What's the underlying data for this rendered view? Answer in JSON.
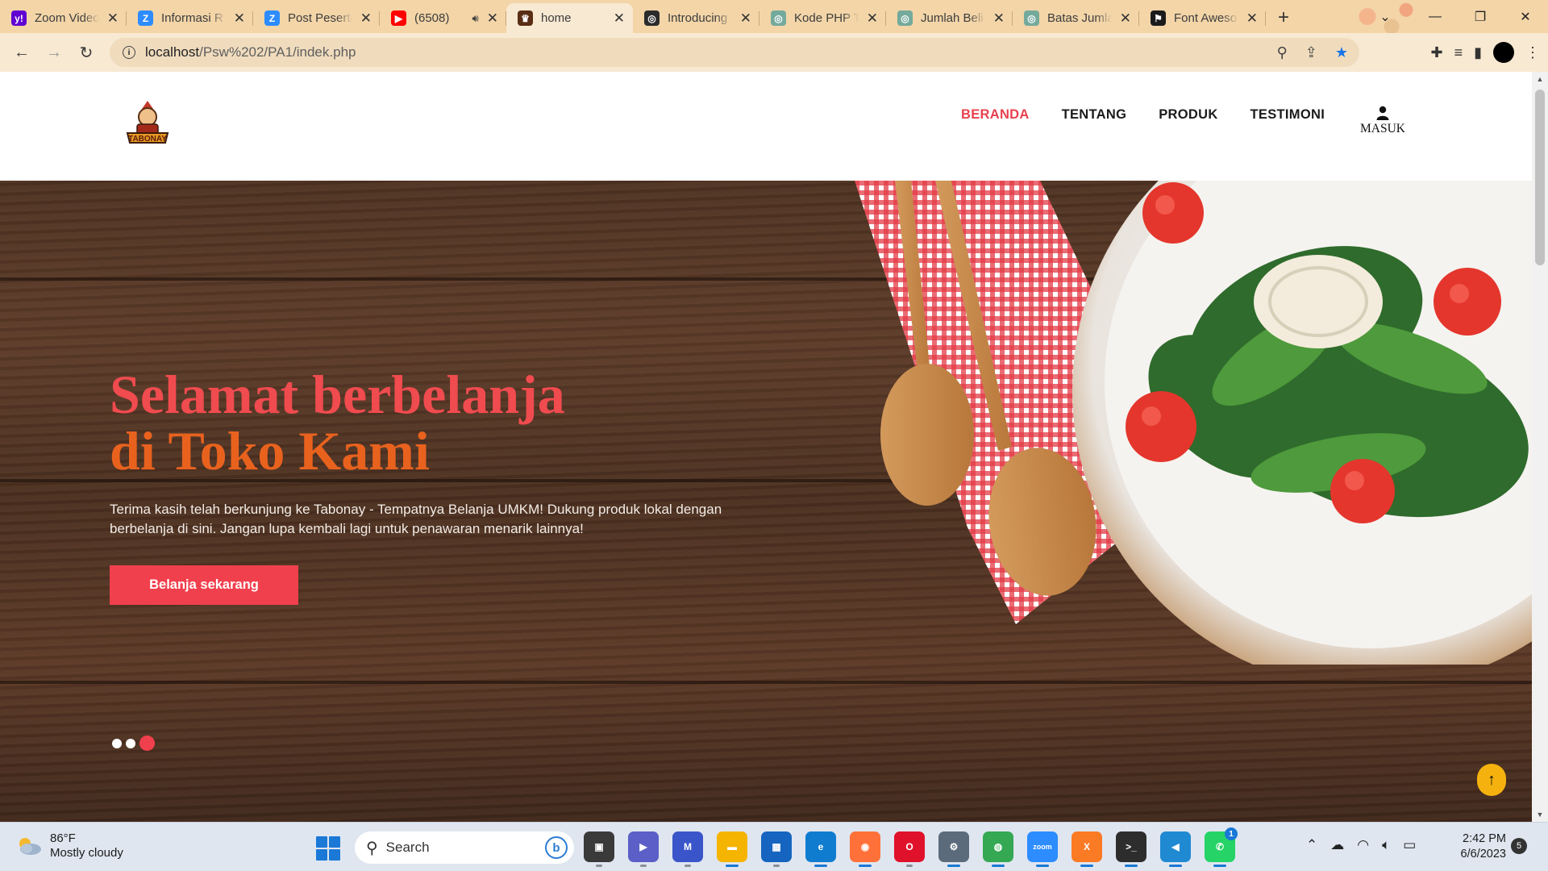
{
  "browser": {
    "tabs": [
      {
        "title": "Zoom Video",
        "icon": "yahoo-icon",
        "color": "#6001d2",
        "glyph": "y!"
      },
      {
        "title": "Informasi R",
        "icon": "zoom-icon",
        "color": "#2d8cff",
        "glyph": "Z"
      },
      {
        "title": "Post Peserta",
        "icon": "zoom-icon",
        "color": "#2d8cff",
        "glyph": "Z"
      },
      {
        "title": "(6508)",
        "icon": "youtube-icon",
        "color": "#ff0000",
        "glyph": "▶"
      },
      {
        "title": "home",
        "icon": "tabonay-icon",
        "color": "#5a2e14",
        "glyph": "♛",
        "active": true
      },
      {
        "title": "Introducing",
        "icon": "openai-icon",
        "color": "#2b2b2b",
        "glyph": "◎"
      },
      {
        "title": "Kode PHP T",
        "icon": "chatgpt-icon",
        "color": "#74aa9c",
        "glyph": "◎"
      },
      {
        "title": "Jumlah Beli",
        "icon": "chatgpt-icon",
        "color": "#74aa9c",
        "glyph": "◎"
      },
      {
        "title": "Batas Jumla",
        "icon": "chatgpt-icon",
        "color": "#74aa9c",
        "glyph": "◎"
      },
      {
        "title": "Font Aweso",
        "icon": "fontawesome-icon",
        "color": "#1b1b1b",
        "glyph": "⚑"
      }
    ],
    "url_host": "localhost",
    "url_path": "/Psw%202/PA1/indek.php"
  },
  "site": {
    "nav": [
      {
        "label": "BERANDA",
        "active": true
      },
      {
        "label": "TENTANG",
        "active": false
      },
      {
        "label": "PRODUK",
        "active": false
      },
      {
        "label": "TESTIMONI",
        "active": false
      }
    ],
    "login_label": "MASUK",
    "hero": {
      "title_line1": "Selamat berbelanja",
      "title_line2": "di Toko Kami",
      "text": "Terima kasih telah berkunjung ke Tabonay - Tempatnya Belanja UMKM! Dukung produk lokal dengan berbelanja di sini. Jangan lupa kembali lagi untuk penawaran menarik lainnya!",
      "button": "Belanja sekarang"
    },
    "logo_text": "TABONAY",
    "brand_colors": {
      "accent": "#f1404d",
      "orange": "#e8621e",
      "scroll_top": "#f5b20e"
    },
    "scroll_top_icon": "arrow-up-icon"
  },
  "taskbar": {
    "weather_temp": "86°F",
    "weather_desc": "Mostly cloudy",
    "search_label": "Search",
    "apps": [
      {
        "name": "task-view-icon",
        "color": "#3a3a3a",
        "glyph": "▣"
      },
      {
        "name": "teams-icon",
        "color": "#5b5fc7",
        "glyph": "▶"
      },
      {
        "name": "editor-icon",
        "color": "#3a55c9",
        "glyph": "M"
      },
      {
        "name": "file-explorer-icon",
        "color": "#f4b400",
        "glyph": "▬",
        "running": true
      },
      {
        "name": "store-icon",
        "color": "#1565c0",
        "glyph": "▦"
      },
      {
        "name": "edge-icon",
        "color": "#0f7ccf",
        "glyph": "e",
        "running": true
      },
      {
        "name": "firefox-icon",
        "color": "#ff7139",
        "glyph": "◉",
        "running": true
      },
      {
        "name": "opera-icon",
        "color": "#e0112b",
        "glyph": "O"
      },
      {
        "name": "settings-icon",
        "color": "#5b6b7c",
        "glyph": "⚙",
        "running": true
      },
      {
        "name": "chrome-icon",
        "color": "#34a853",
        "glyph": "◍",
        "running": true
      },
      {
        "name": "zoom-app-icon",
        "color": "#2d8cff",
        "glyph": "zoom",
        "running": true
      },
      {
        "name": "xampp-icon",
        "color": "#fb7a24",
        "glyph": "X",
        "running": true
      },
      {
        "name": "terminal-icon",
        "color": "#2d2d2d",
        "glyph": ">_",
        "running": true
      },
      {
        "name": "vscode-icon",
        "color": "#1f8ad2",
        "glyph": "◀",
        "running": true
      },
      {
        "name": "whatsapp-icon",
        "color": "#25d366",
        "glyph": "✆",
        "running": true,
        "badge": "1"
      }
    ],
    "time": "2:42 PM",
    "date": "6/6/2023",
    "notifications": "5"
  }
}
